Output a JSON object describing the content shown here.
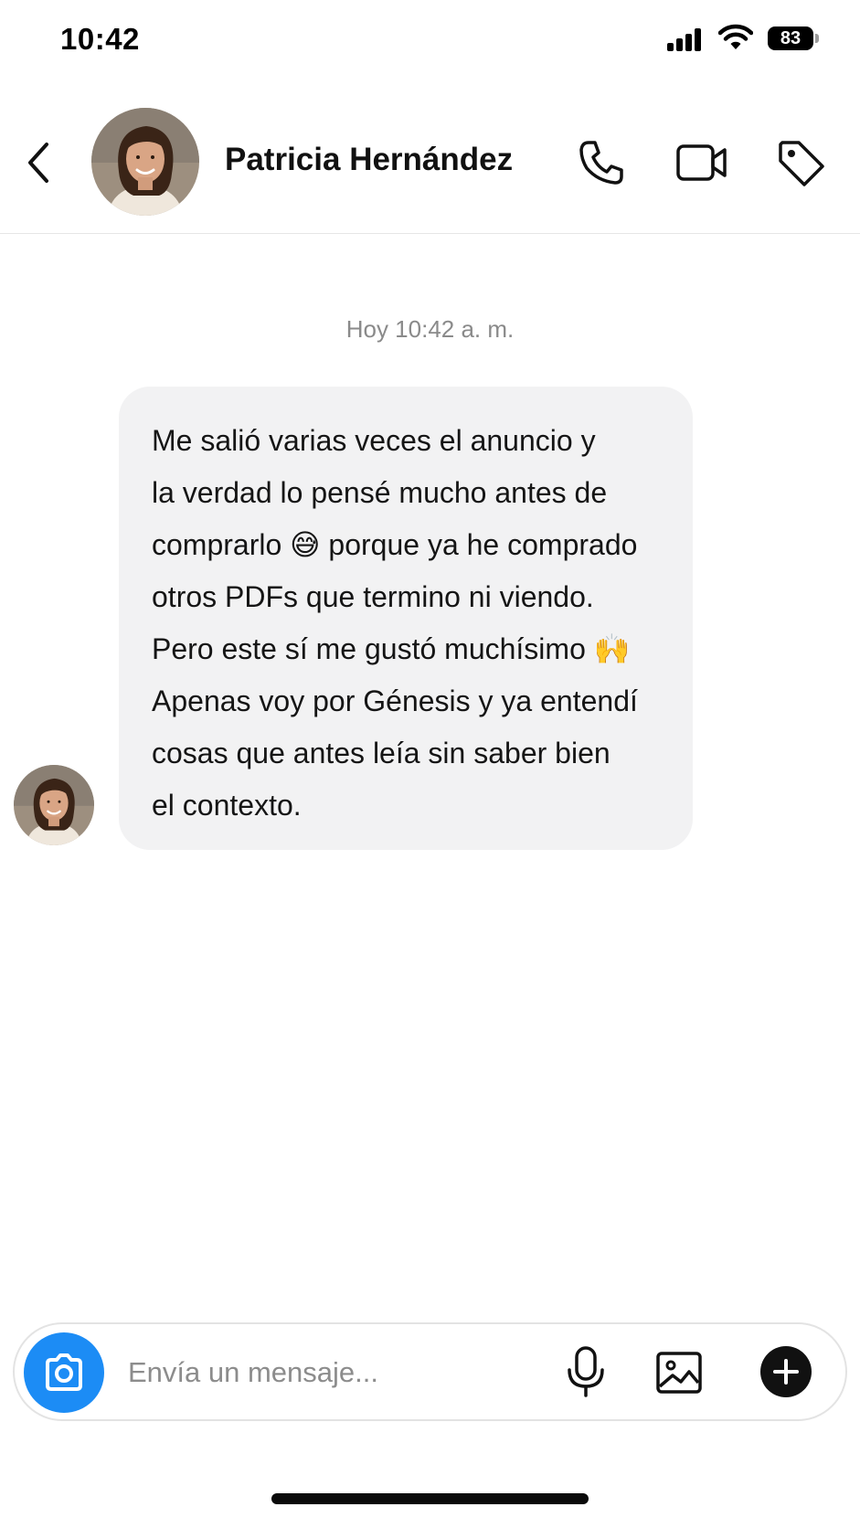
{
  "status_bar": {
    "time": "10:42",
    "battery": "83"
  },
  "header": {
    "contact_name": "Patricia Hernández",
    "icons": [
      "back-arrow-icon",
      "phone-icon",
      "video-camera-icon",
      "tag-icon"
    ]
  },
  "chat": {
    "timestamp": "Hoy 10:42 a. m.",
    "messages": [
      {
        "sender": "Patricia Hernández",
        "lines": [
          "Me salió varias veces el anuncio y",
          "la verdad lo pensé mucho antes de",
          "comprarlo 😅 porque ya he comprado",
          "otros PDFs que termino ni viendo.",
          "Pero este sí me gustó muchísimo 🙌",
          "Apenas voy por Génesis y ya entendí",
          "cosas que antes leía sin saber bien",
          "el contexto."
        ]
      }
    ]
  },
  "composer": {
    "placeholder": "Envía un mensaje...",
    "icons": [
      "camera-icon",
      "microphone-icon",
      "image-icon",
      "plus-icon"
    ]
  },
  "colors": {
    "accent": "#1c8cf5",
    "bubble": "#f2f2f3",
    "text": "#151515",
    "muted": "#8a8a8a"
  }
}
